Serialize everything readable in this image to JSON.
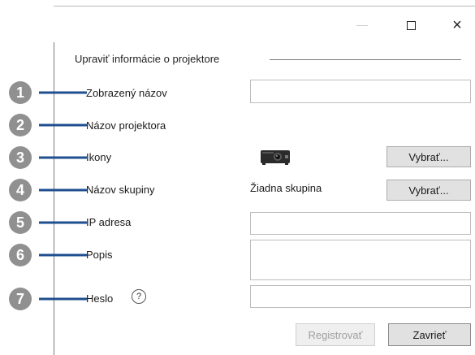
{
  "window": {
    "buttons": [
      "minimize",
      "maximize",
      "close"
    ],
    "close_glyph": "×"
  },
  "section": {
    "title": "Upraviť informácie o projektore"
  },
  "fields": {
    "display_name": {
      "label": "Zobrazený názov",
      "value": ""
    },
    "projector_name": {
      "label": "Názov projektora",
      "value": ""
    },
    "icons": {
      "label": "Ikony",
      "button": "Vybrať..."
    },
    "group_name": {
      "label": "Názov skupiny",
      "value": "Žiadna skupina",
      "button": "Vybrať..."
    },
    "ip_address": {
      "label": "IP adresa",
      "value": ""
    },
    "description": {
      "label": "Popis",
      "value": ""
    },
    "password": {
      "label": "Heslo",
      "help_glyph": "?",
      "value": ""
    }
  },
  "footer": {
    "register_label": "Registrovať",
    "close_label": "Zavrieť"
  },
  "callouts": [
    "1",
    "2",
    "3",
    "4",
    "5",
    "6",
    "7"
  ],
  "colors": {
    "callout": "#909090",
    "connector": "#1f4f8f"
  }
}
